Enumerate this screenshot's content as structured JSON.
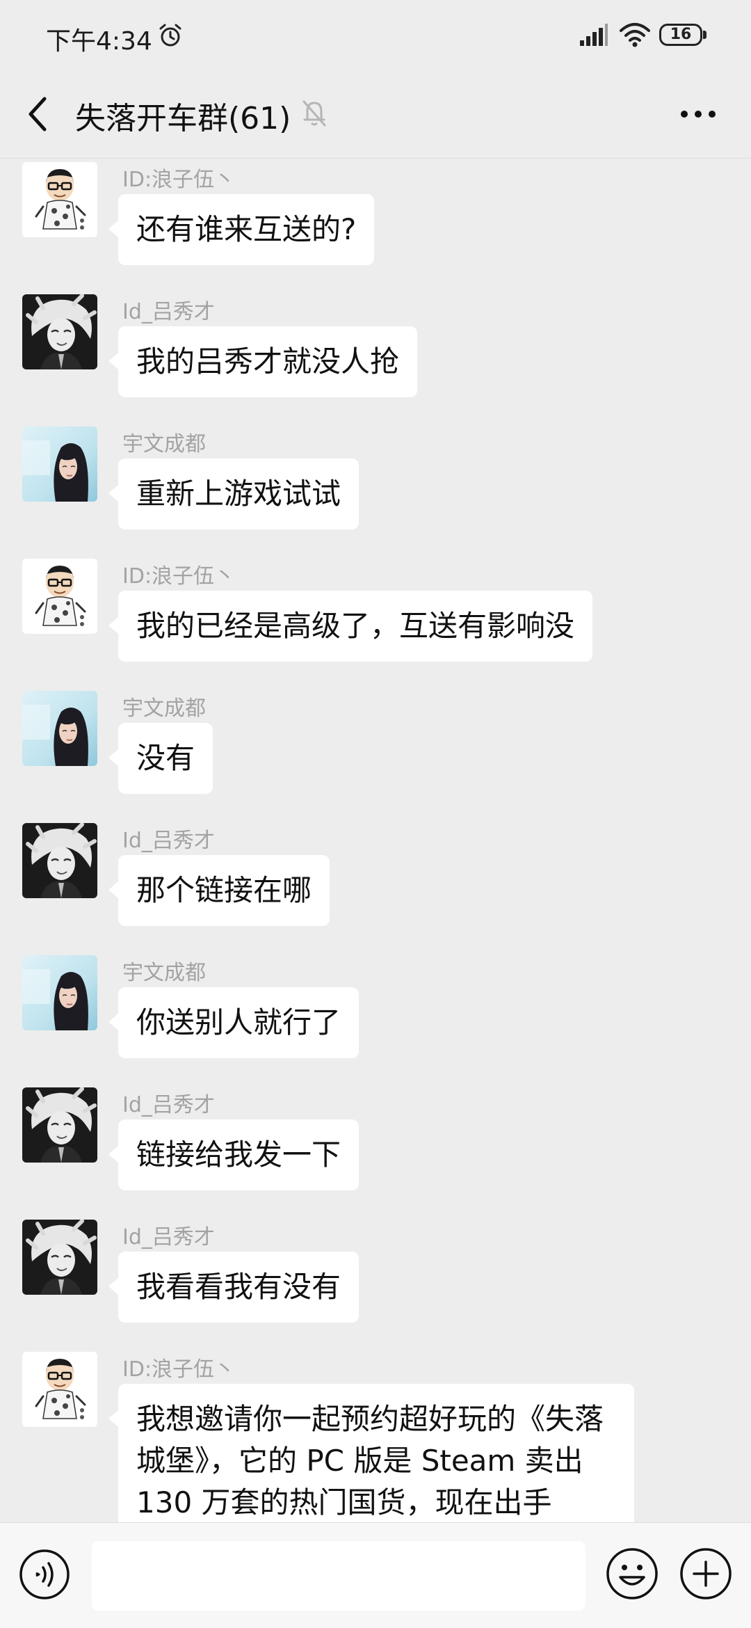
{
  "status": {
    "time": "下午4:34",
    "battery": "16"
  },
  "header": {
    "title": "失落开车群(61)"
  },
  "messages": [
    {
      "sender": "ID:浪子伍丶",
      "avatar": "cartoon-man-avatar",
      "text": "还有谁来互送的?"
    },
    {
      "sender": "Id_吕秀才",
      "avatar": "anime-white-hair-avatar",
      "text": "我的吕秀才就没人抢"
    },
    {
      "sender": "宇文成都",
      "avatar": "woman-photo-avatar",
      "text": "重新上游戏试试"
    },
    {
      "sender": "ID:浪子伍丶",
      "avatar": "cartoon-man-avatar",
      "text": "我的已经是高级了，互送有影响没"
    },
    {
      "sender": "宇文成都",
      "avatar": "woman-photo-avatar",
      "text": "没有"
    },
    {
      "sender": "Id_吕秀才",
      "avatar": "anime-white-hair-avatar",
      "text": "那个链接在哪"
    },
    {
      "sender": "宇文成都",
      "avatar": "woman-photo-avatar",
      "text": "你送别人就行了"
    },
    {
      "sender": "Id_吕秀才",
      "avatar": "anime-white-hair-avatar",
      "text": "链接给我发一下"
    },
    {
      "sender": "Id_吕秀才",
      "avatar": "anime-white-hair-avatar",
      "text": "我看看我有没有"
    },
    {
      "sender": "ID:浪子伍丶",
      "avatar": "cartoon-man-avatar",
      "text": "我想邀请你一起预约超好玩的《失落城堡》，它的 PC 版是 Steam 卖出 130 万套的热门国货，现在出手"
    }
  ],
  "input": {
    "value": "",
    "placeholder": ""
  },
  "icons": {
    "alarm": "alarm-clock-icon",
    "signal": "cellular-signal-icon",
    "wifi": "wifi-icon",
    "back": "chevron-left-icon",
    "mute": "bell-off-icon",
    "more": "more-dots-icon",
    "voice": "voice-icon",
    "emoji": "emoji-icon",
    "plus": "plus-icon"
  },
  "colors": {
    "background": "#ededed",
    "bubble": "#ffffff",
    "sender_text": "#a3a3a3"
  }
}
